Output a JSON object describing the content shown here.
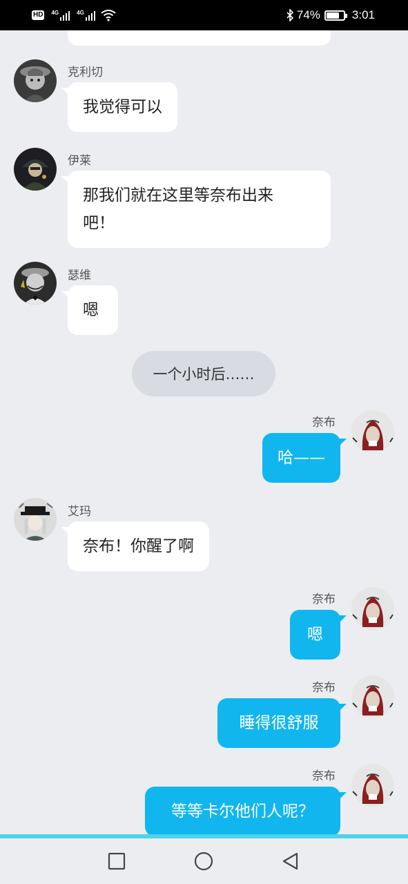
{
  "status_bar": {
    "hd_badge": "HD",
    "sim_label_1": "4G",
    "sim_label_2": "4G",
    "battery_text": "74%",
    "battery_level": 0.74,
    "time": "3:01",
    "icons": [
      "hd-icon",
      "signal-icon",
      "wifi-icon",
      "bluetooth-icon",
      "battery-icon"
    ]
  },
  "chat": {
    "messages": [
      {
        "side": "left",
        "sender": "克利切",
        "text": "我觉得可以",
        "avatar": "avatar-kelieqie"
      },
      {
        "side": "left",
        "sender": "伊莱",
        "text_line1": "那我们就在这里等奈布出来",
        "text_line2": "吧！",
        "avatar": "avatar-yilai"
      },
      {
        "side": "left",
        "sender": "瑟维",
        "text": "嗯",
        "avatar": "avatar-sewei"
      },
      {
        "side": "system",
        "text": "一个小时后……"
      },
      {
        "side": "right",
        "sender": "奈布",
        "text": "哈——",
        "avatar": "avatar-naibu"
      },
      {
        "side": "left",
        "sender": "艾玛",
        "text": "奈布！你醒了啊",
        "avatar": "avatar-aima"
      },
      {
        "side": "right",
        "sender": "奈布",
        "text": "嗯",
        "avatar": "avatar-naibu"
      },
      {
        "side": "right",
        "sender": "奈布",
        "text": "睡得很舒服",
        "avatar": "avatar-naibu"
      },
      {
        "side": "right",
        "sender": "奈布",
        "text": "等等卡尔他们人呢？",
        "avatar": "avatar-naibu"
      }
    ]
  },
  "nav_bar": {
    "buttons": [
      "recent-apps-icon",
      "home-icon",
      "back-icon"
    ]
  },
  "colors": {
    "background": "#ecedf1",
    "bubble_left": "#ffffff",
    "bubble_right": "#11b6ef",
    "system_pill": "#d8dbe2",
    "nav_accent": "#4cd4ea"
  }
}
